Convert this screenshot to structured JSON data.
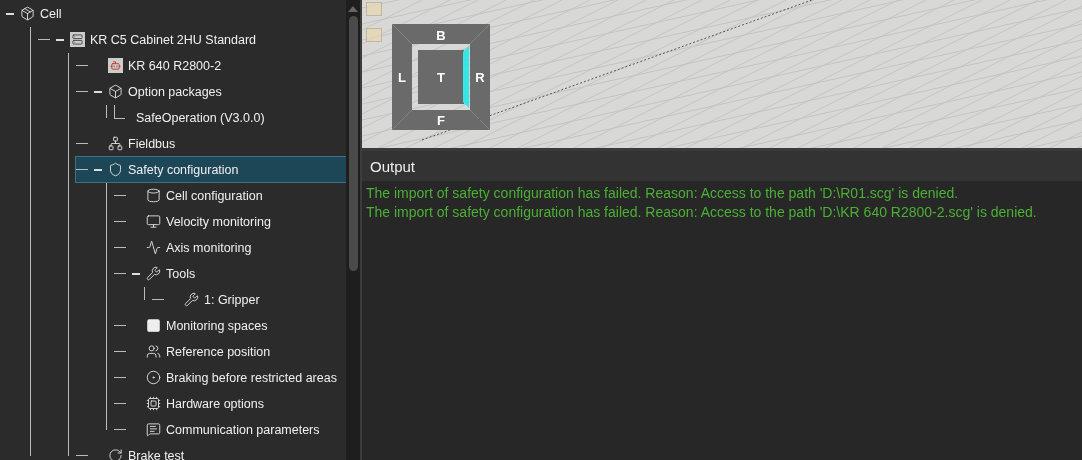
{
  "tree": [
    {
      "label": "Cell",
      "kind": "cell",
      "expanded": true,
      "selected": false,
      "children": [
        {
          "label": "KR C5 Cabinet 2HU Standard",
          "kind": "cabinet",
          "expanded": true,
          "selected": false,
          "children": [
            {
              "label": "KR 640 R2800-2",
              "kind": "robot",
              "selected": false
            },
            {
              "label": "Option packages",
              "kind": "package",
              "expanded": true,
              "selected": false,
              "children": [
                {
                  "label": "SafeOperation (V3.0.0)",
                  "kind": "none",
                  "selected": false
                }
              ]
            },
            {
              "label": "Fieldbus",
              "kind": "fieldbus",
              "selected": false
            },
            {
              "label": "Safety configuration",
              "kind": "safety",
              "expanded": true,
              "selected": true,
              "children": [
                {
                  "label": "Cell configuration",
                  "kind": "cylinder",
                  "selected": false
                },
                {
                  "label": "Velocity monitoring",
                  "kind": "monitor",
                  "selected": false
                },
                {
                  "label": "Axis monitoring",
                  "kind": "axis",
                  "selected": false
                },
                {
                  "label": "Tools",
                  "kind": "tool",
                  "expanded": true,
                  "selected": false,
                  "children": [
                    {
                      "label": "1: Gripper",
                      "kind": "tool",
                      "selected": false
                    }
                  ]
                },
                {
                  "label": "Monitoring spaces",
                  "kind": "space",
                  "selected": false
                },
                {
                  "label": "Reference position",
                  "kind": "reference",
                  "selected": false
                },
                {
                  "label": "Braking before restricted areas",
                  "kind": "braking",
                  "selected": false
                },
                {
                  "label": "Hardware options",
                  "kind": "chip",
                  "selected": false
                },
                {
                  "label": "Communication parameters",
                  "kind": "message",
                  "selected": false
                }
              ]
            },
            {
              "label": "Brake test",
              "kind": "brake",
              "selected": false
            }
          ]
        }
      ]
    }
  ],
  "view_cube": {
    "back": "B",
    "left": "L",
    "top": "T",
    "right": "R",
    "front": "F"
  },
  "output": {
    "title": "Output",
    "lines": [
      "The import of safety configuration has failed. Reason: Access to the path 'D:\\R01.scg' is denied.",
      "The import of safety configuration has failed. Reason: Access to the path 'D:\\KR 640 R2800-2.scg' is denied."
    ]
  }
}
